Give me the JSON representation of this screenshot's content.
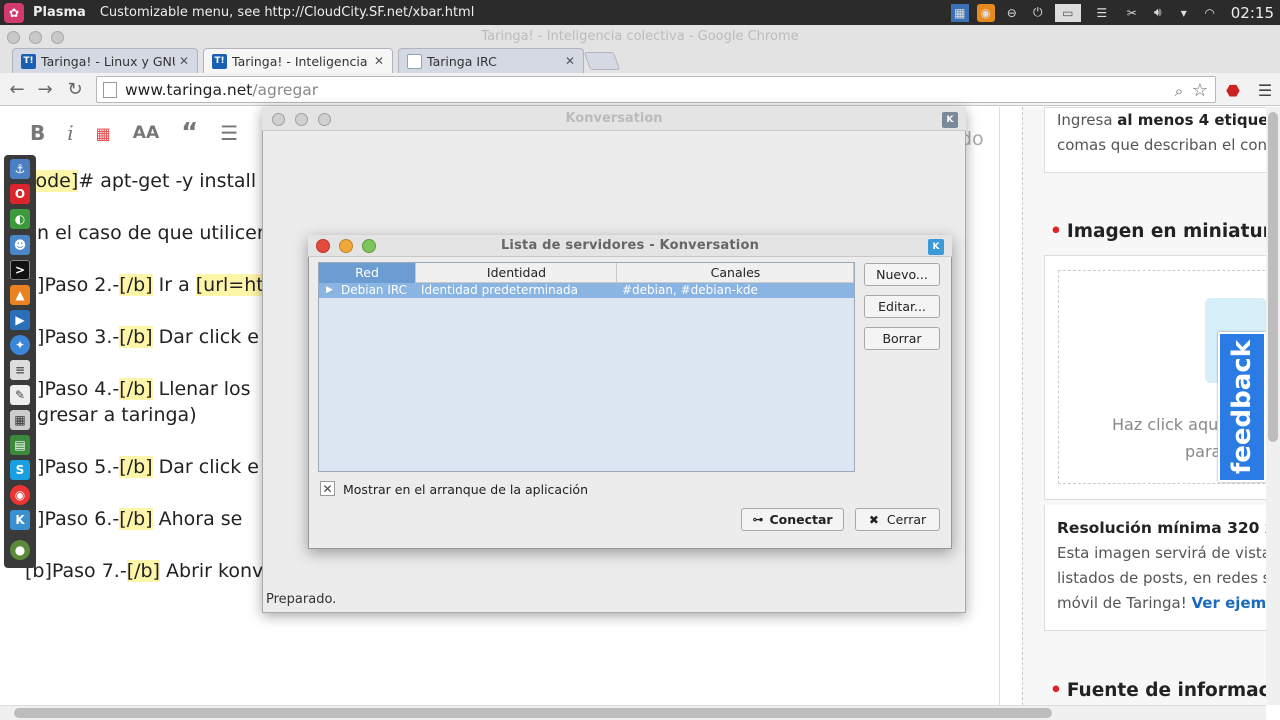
{
  "panel": {
    "title": "Plasma",
    "message": "Customizable menu, see http://CloudCity.SF.net/xbar.html",
    "clock": "02:15"
  },
  "browser": {
    "window_title": "Taringa! - Inteligencia colectiva - Google Chrome",
    "tabs": [
      {
        "label": "Taringa! - Linux y GNU",
        "favicon": "T!"
      },
      {
        "label": "Taringa! - Inteligencia",
        "favicon": "T!"
      },
      {
        "label": "Taringa IRC",
        "favicon": ""
      }
    ],
    "url_host": "www.taringa.net",
    "url_path": "/agregar"
  },
  "editor": {
    "tools": [
      "B",
      "i",
      "AA",
      "“"
    ],
    "placeholder_fragment": "do",
    "lines": [
      {
        "pre": "",
        "hl": "code]",
        "post": "# apt-get -y install k"
      },
      {
        "pre": "En el caso de que utilicen",
        "hl": "",
        "post": ""
      },
      {
        "pre": "b]Paso 2.-",
        "hl": "[/b]",
        "post": " Ir a ",
        "hl2": "[url=ht"
      },
      {
        "pre": "b]Paso 3.-",
        "hl": "[/b]",
        "post": " Dar click e"
      },
      {
        "pre": "b]Paso 4.-",
        "hl": "[/b]",
        "post": "  Llenar los"
      },
      {
        "pre": "ngresar a taringa)",
        "hl": "",
        "post": ""
      },
      {
        "pre": "b]Paso 5.-",
        "hl": "[/b]",
        "post": " Dar click e"
      },
      {
        "pre": "b]Paso 6.-",
        "hl": "[/b]",
        "post": " Ahora se"
      },
      {
        "pre": "[b]Paso 7.-",
        "hl": "[/b]",
        "post": " Abrir konv"
      }
    ]
  },
  "sidebar": {
    "tags_text_1": "Ingresa ",
    "tags_text_bold": "al menos 4 etiqueta",
    "tags_text_2": "comas que describan el cont",
    "thumb_heading": "Imagen en miniatura",
    "thumb_click": "Haz click aqu",
    "thumb_para": "para",
    "feedback": "feedback",
    "res_heading": "Resolución mínima 320 x 3",
    "res_line1": "Esta imagen servirá de vista",
    "res_line2": "listados de posts, en redes s",
    "res_line3": "móvil de Taringa! ",
    "res_link": "Ver ejemp",
    "source_heading": "Fuente de informaci"
  },
  "konversation": {
    "title": "Konversation",
    "status": "Preparado."
  },
  "server_dialog": {
    "title": "Lista de servidores - Konversation",
    "columns": [
      "Red",
      "Identidad",
      "Canales"
    ],
    "rows": [
      {
        "network": "Debian IRC",
        "identity": "Identidad predeterminada",
        "channels": "#debian, #debian-kde"
      }
    ],
    "buttons": {
      "new": "Nuevo...",
      "edit": "Editar...",
      "delete": "Borrar",
      "connect": "Conectar",
      "close": "Cerrar"
    },
    "startup_checkbox": "Mostrar en el arranque de la aplicación",
    "startup_checked": true
  },
  "colors": {
    "selection": "#8ab4e2",
    "header_selected": "#6c9dd2",
    "feedback": "#2a7be4",
    "highlight": "#fdf5a8"
  }
}
